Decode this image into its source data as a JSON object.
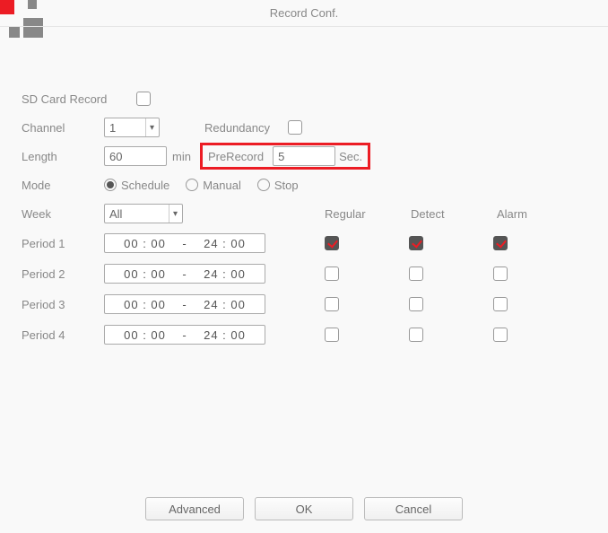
{
  "title": "Record Conf.",
  "labels": {
    "sd_card_record": "SD Card Record",
    "channel": "Channel",
    "redundancy": "Redundancy",
    "length": "Length",
    "min": "min",
    "prerecord": "PreRecord",
    "sec": "Sec.",
    "mode": "Mode",
    "week": "Week"
  },
  "values": {
    "channel": "1",
    "length": "60",
    "prerecord": "5",
    "week": "All"
  },
  "mode_options": {
    "schedule": "Schedule",
    "manual": "Manual",
    "stop": "Stop"
  },
  "columns": {
    "regular": "Regular",
    "detect": "Detect",
    "alarm": "Alarm"
  },
  "periods": [
    {
      "label": "Period 1",
      "range": "00 : 00    -    24 : 00",
      "regular": true,
      "detect": true,
      "alarm": true
    },
    {
      "label": "Period 2",
      "range": "00 : 00    -    24 : 00",
      "regular": false,
      "detect": false,
      "alarm": false
    },
    {
      "label": "Period 3",
      "range": "00 : 00    -    24 : 00",
      "regular": false,
      "detect": false,
      "alarm": false
    },
    {
      "label": "Period 4",
      "range": "00 : 00    -    24 : 00",
      "regular": false,
      "detect": false,
      "alarm": false
    }
  ],
  "buttons": {
    "advanced": "Advanced",
    "ok": "OK",
    "cancel": "Cancel"
  }
}
